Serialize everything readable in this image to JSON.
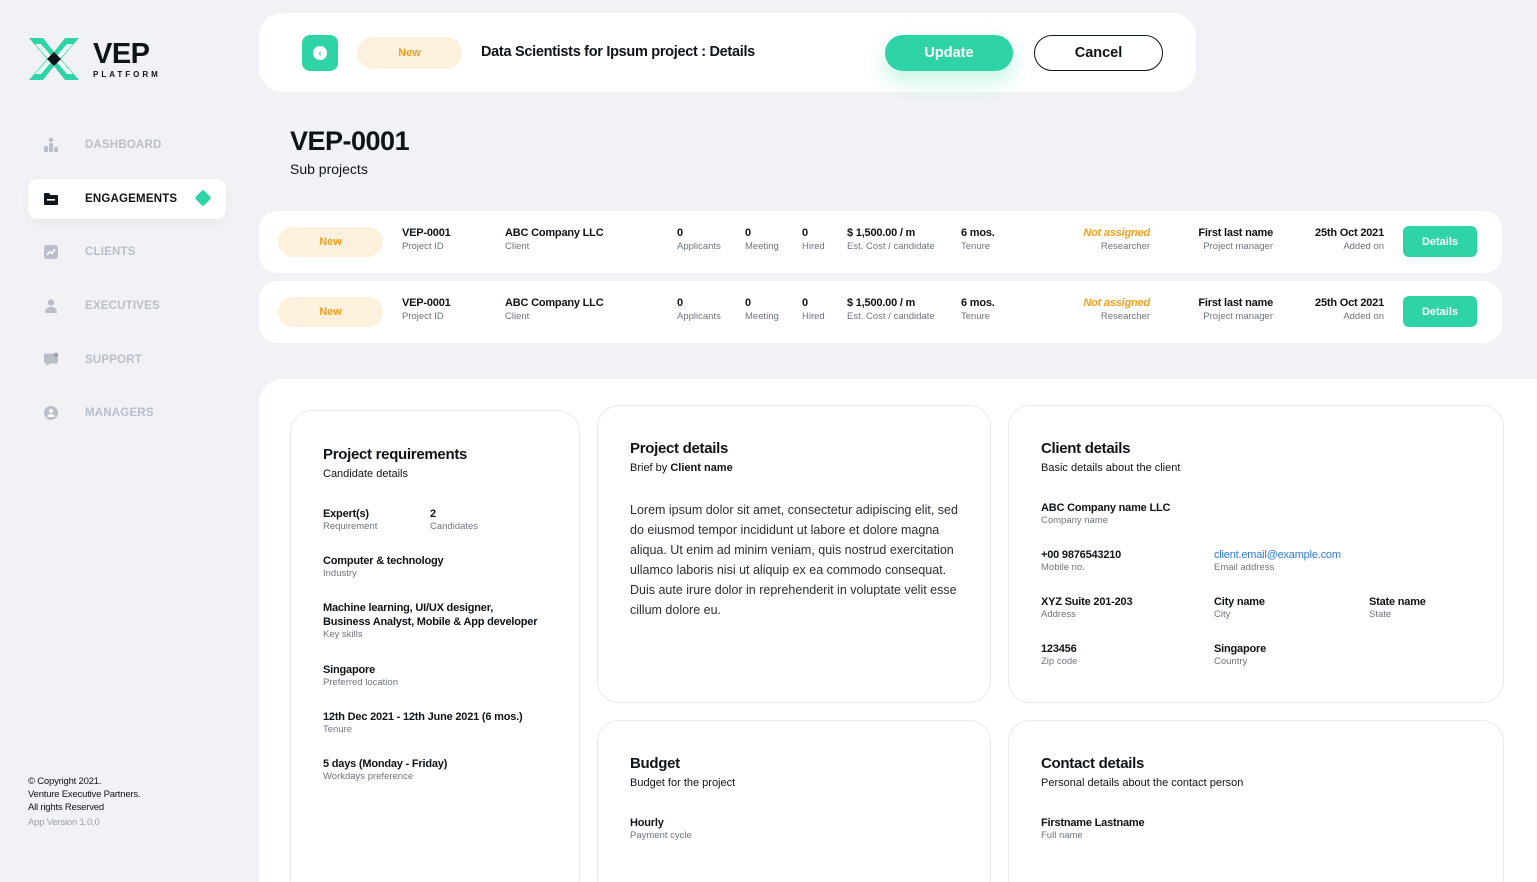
{
  "app": {
    "logo_title": "VEP",
    "logo_subtitle": "PLATFORM",
    "brand_color": "#2ed3a6",
    "warning_color": "#f0a01f"
  },
  "sidebar": {
    "items": [
      {
        "label": "DASHBOARD",
        "icon": "chart-icon",
        "active": false
      },
      {
        "label": "ENGAGEMENTS",
        "icon": "folder-icon",
        "active": true
      },
      {
        "label": "CLIENTS",
        "icon": "trend-icon",
        "active": false
      },
      {
        "label": "EXECUTIVES",
        "icon": "person-icon",
        "active": false
      },
      {
        "label": "SUPPORT",
        "icon": "chat-icon",
        "active": false
      },
      {
        "label": "MANAGERS",
        "icon": "user-badge-icon",
        "active": false
      }
    ],
    "footer": {
      "line1": "© Copyright 2021.",
      "line2": "Venture Executive Partners.",
      "line3": "All rights Reserved",
      "version": "App Version 1.0.0"
    }
  },
  "topbar": {
    "status": "New",
    "title": "Data Scientists for Ipsum project : Details",
    "update_label": "Update",
    "cancel_label": "Cancel"
  },
  "page": {
    "id": "VEP-0001",
    "subtitle": "Sub projects"
  },
  "rows": [
    {
      "status": "New",
      "project_id": "VEP-0001",
      "project_id_label": "Project ID",
      "client": "ABC Company LLC",
      "client_label": "Client",
      "applicants": "0",
      "applicants_label": "Applicants",
      "meeting": "0",
      "meeting_label": "Meeting",
      "hired": "0",
      "hired_label": "Hired",
      "cost": "$ 1,500.00 / m",
      "cost_label": "Est. Cost / candidate",
      "tenure": "6 mos.",
      "tenure_label": "Tenure",
      "researcher": "Not assigned",
      "researcher_label": "Researcher",
      "manager": "First last name",
      "manager_label": "Project manager",
      "added": "25th Oct 2021",
      "added_label": "Added on",
      "details_label": "Details"
    },
    {
      "status": "New",
      "project_id": "VEP-0001",
      "project_id_label": "Project ID",
      "client": "ABC Company LLC",
      "client_label": "Client",
      "applicants": "0",
      "applicants_label": "Applicants",
      "meeting": "0",
      "meeting_label": "Meeting",
      "hired": "0",
      "hired_label": "Hired",
      "cost": "$ 1,500.00 / m",
      "cost_label": "Est. Cost / candidate",
      "tenure": "6 mos.",
      "tenure_label": "Tenure",
      "researcher": "Not assigned",
      "researcher_label": "Researcher",
      "manager": "First last name",
      "manager_label": "Project manager",
      "added": "25th Oct 2021",
      "added_label": "Added on",
      "details_label": "Details"
    }
  ],
  "requirements": {
    "title": "Project requirements",
    "subtitle": "Candidate details",
    "expert_value": "Expert(s)",
    "expert_label": "Requirement",
    "count_value": "2",
    "count_label": "Candidates",
    "industry_value": "Computer & technology",
    "industry_label": "Industry",
    "skills_value_1": "Machine learning, UI/UX designer,",
    "skills_value_2": "Business Analyst, Mobile & App developer",
    "skills_label": "Key skills",
    "location_value": "Singapore",
    "location_label": "Preferred location",
    "tenure_value": "12th Dec 2021 - 12th June 2021 (6 mos.)",
    "tenure_label": "Tenure",
    "workdays_value": "5 days (Monday - Friday)",
    "workdays_label": "Workdays preference"
  },
  "project_details": {
    "title": "Project details",
    "brief_prefix": "Brief by ",
    "brief_name": "Client name",
    "body": "Lorem ipsum dolor sit amet, consectetur adipiscing elit, sed do eiusmod tempor incididunt ut labore et dolore magna aliqua. Ut enim ad minim veniam, quis nostrud exercitation ullamco laboris nisi ut aliquip ex ea commodo consequat.  Duis aute irure dolor in reprehenderit in voluptate velit esse cillum dolore eu."
  },
  "client_details": {
    "title": "Client details",
    "subtitle": "Basic details about the client",
    "company_value": "ABC Company name LLC",
    "company_label": "Company name",
    "mobile_value": "+00 9876543210",
    "mobile_label": "Mobile no.",
    "email_value": "client.email@example.com",
    "email_label": "Email address",
    "address_value": "XYZ Suite 201-203",
    "address_label": "Address",
    "city_value": "City name",
    "city_label": "City",
    "state_value": "State name",
    "state_label": "State",
    "zip_value": "123456",
    "zip_label": "Zip code",
    "country_value": "Singapore",
    "country_label": "Country"
  },
  "budget": {
    "title": "Budget",
    "subtitle": "Budget for the project",
    "cycle_value": "Hourly",
    "cycle_label": "Payment cycle"
  },
  "contact": {
    "title": "Contact details",
    "subtitle": "Personal details about the contact person",
    "name_value": "Firstname Lastname",
    "name_label": "Full name"
  }
}
